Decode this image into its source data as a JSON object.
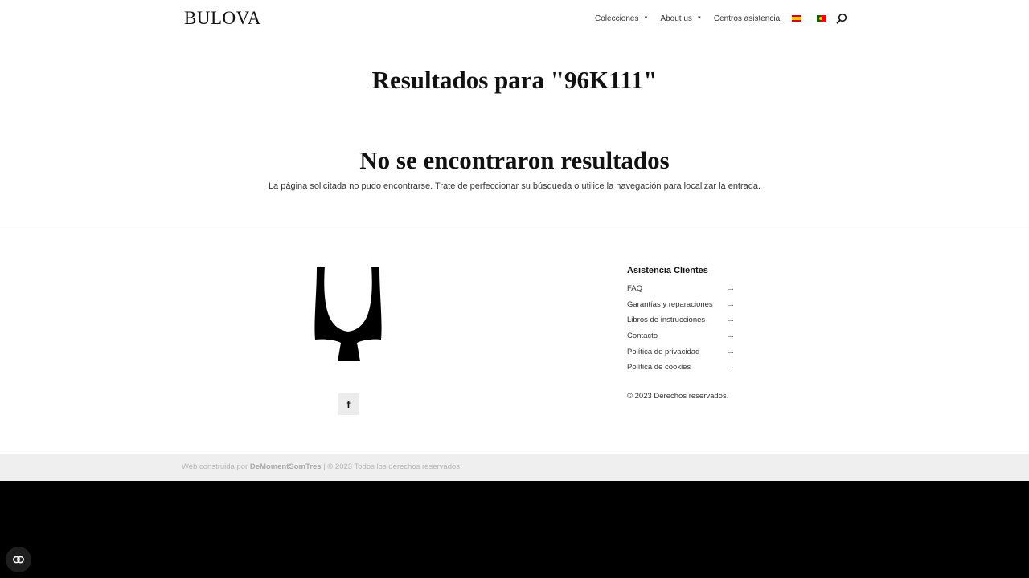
{
  "header": {
    "logo": "BULOVA",
    "nav": [
      {
        "label": "Colecciones",
        "has_dropdown": true
      },
      {
        "label": "About us",
        "has_dropdown": true
      },
      {
        "label": "Centros asistencia",
        "has_dropdown": false
      }
    ],
    "languages": [
      {
        "code": "es",
        "icon": "spain-flag-icon"
      },
      {
        "code": "pt",
        "icon": "portugal-flag-icon"
      }
    ],
    "search_icon": "search-icon"
  },
  "main": {
    "results_title": "Resultados para \"96K111\"",
    "no_results_heading": "No se encontraron resultados",
    "no_results_text": "La página solicitada no pudo encontrarse. Trate de perfeccionar su búsqueda o utilice la navegación para localizar la entrada."
  },
  "footer": {
    "logo_icon": "bulova-tuning-fork-icon",
    "social_label": "f",
    "column_title": "Asistencia Clientes",
    "links": [
      "FAQ",
      "Garantías y reparaciones",
      "Libros de instrucciones",
      "Contacto",
      "Política de privacidad",
      "Política de cookies"
    ],
    "link_arrow": "→",
    "copyright": "© 2023 Derechos reservados.",
    "bottom_prefix": "Web construida por ",
    "bottom_author": "DeMomentSomTres",
    "bottom_suffix": " | © 2023 Todos los derechos reservados."
  },
  "colors": {
    "text": "#222222",
    "bottom_bar": "#efefef",
    "background_dark": "#000000"
  }
}
